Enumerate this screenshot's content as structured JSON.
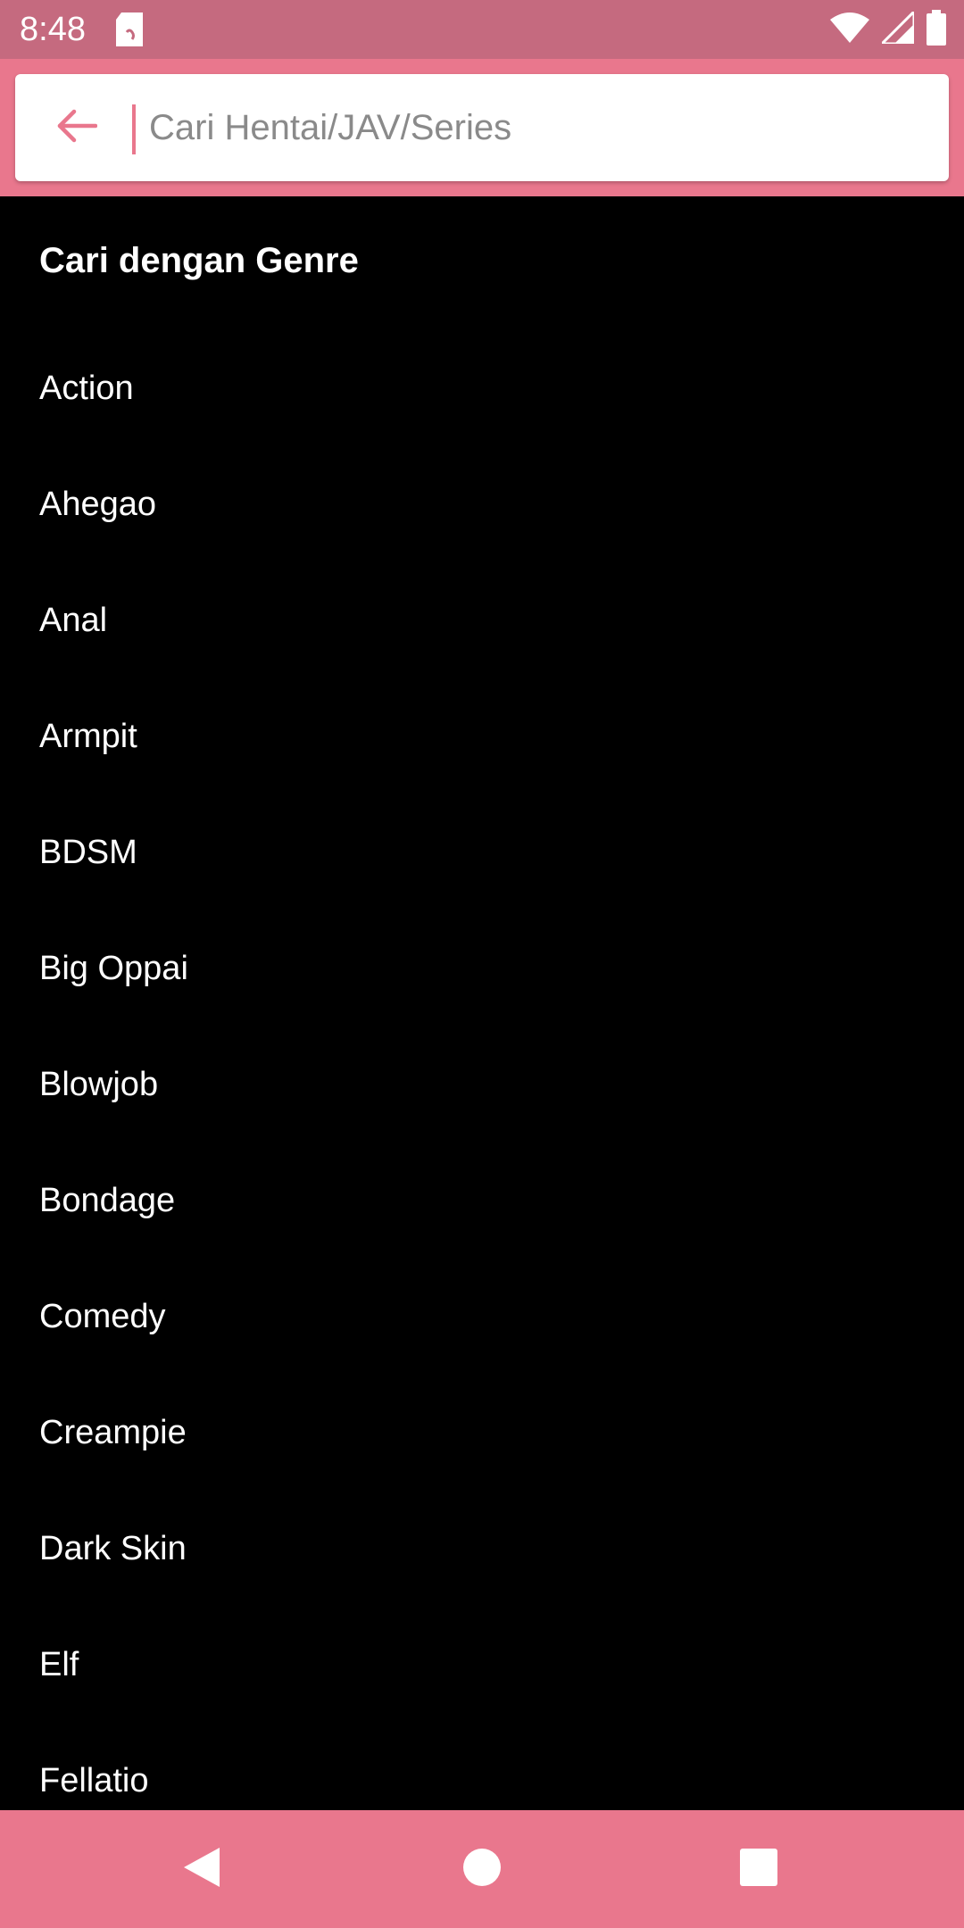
{
  "status_bar": {
    "time": "8:48",
    "icons": [
      "sd-card-icon",
      "wifi-icon",
      "signal-icon",
      "battery-icon"
    ]
  },
  "search": {
    "placeholder": "Cari Hentai/JAV/Series",
    "value": "",
    "back_icon": "arrow-back-icon"
  },
  "genre_section": {
    "title": "Cari dengan Genre",
    "items": [
      {
        "label": "Action"
      },
      {
        "label": "Ahegao"
      },
      {
        "label": "Anal"
      },
      {
        "label": "Armpit"
      },
      {
        "label": "BDSM"
      },
      {
        "label": "Big Oppai"
      },
      {
        "label": "Blowjob"
      },
      {
        "label": "Bondage"
      },
      {
        "label": "Comedy"
      },
      {
        "label": "Creampie"
      },
      {
        "label": "Dark Skin"
      },
      {
        "label": "Elf"
      },
      {
        "label": "Fellatio"
      }
    ]
  },
  "nav_bar": {
    "buttons": [
      "back-triangle-icon",
      "home-circle-icon",
      "recents-square-icon"
    ]
  },
  "colors": {
    "status_bar": "#c56a7f",
    "accent": "#e9778d",
    "background": "#000000",
    "text": "#ffffff"
  }
}
